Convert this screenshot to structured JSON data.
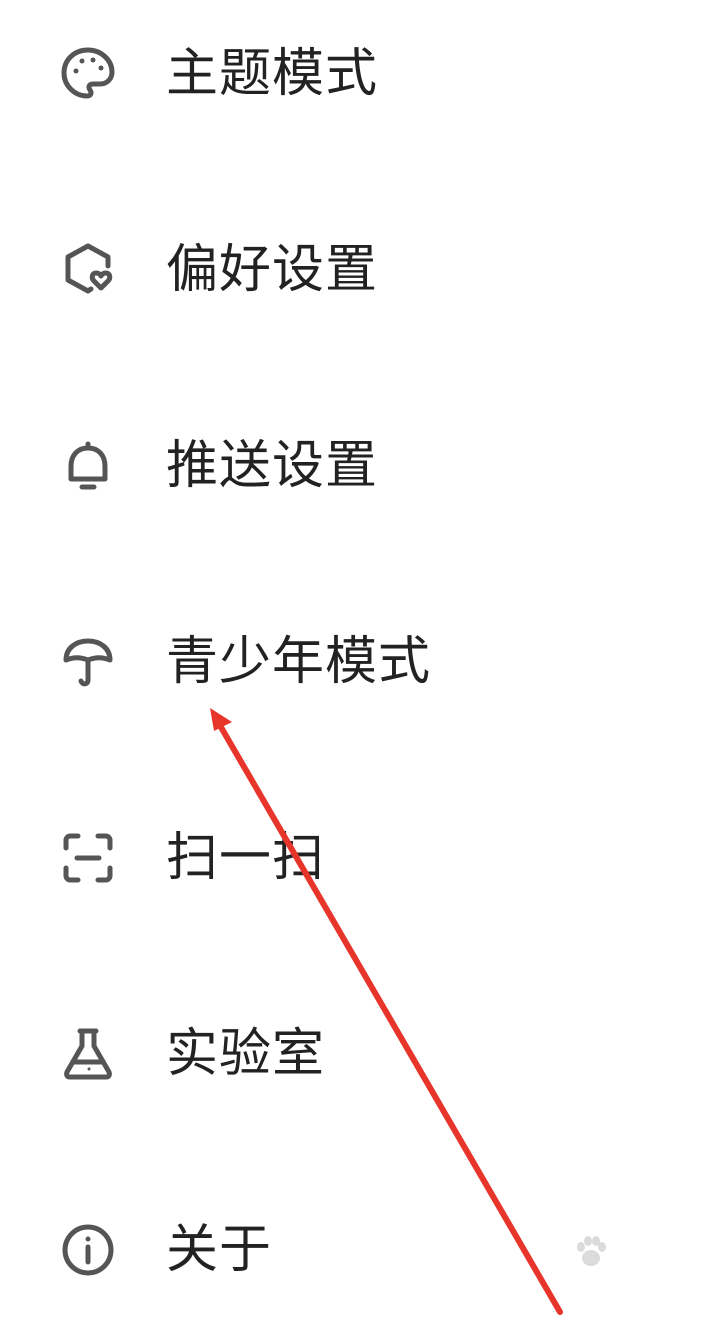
{
  "menu": {
    "items": [
      {
        "label": "主题模式",
        "icon": "palette-icon"
      },
      {
        "label": "偏好设置",
        "icon": "hexagon-heart-icon"
      },
      {
        "label": "推送设置",
        "icon": "bell-icon"
      },
      {
        "label": "青少年模式",
        "icon": "umbrella-icon"
      },
      {
        "label": "扫一扫",
        "icon": "scan-icon"
      },
      {
        "label": "实验室",
        "icon": "flask-icon"
      },
      {
        "label": "关于",
        "icon": "info-icon"
      }
    ]
  },
  "annotation": {
    "arrow_color": "#e8352b"
  },
  "colors": {
    "icon": "#555555",
    "text": "#222222",
    "background": "#ffffff"
  }
}
